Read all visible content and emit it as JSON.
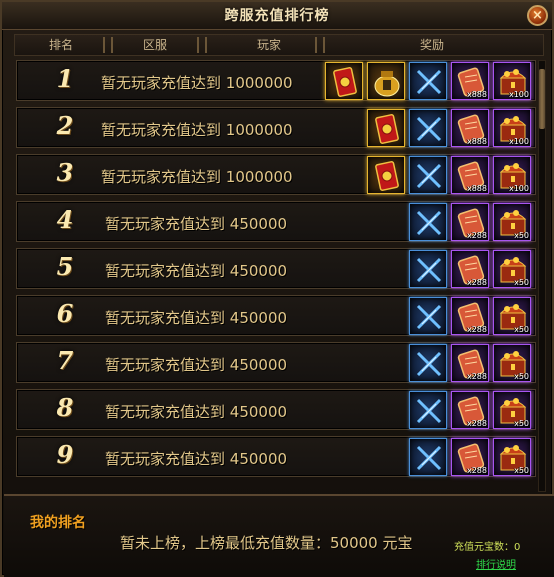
{
  "window": {
    "title": "跨服充值排行榜",
    "close_label": "×"
  },
  "columns": {
    "rank": "排名",
    "server": "区服",
    "player": "玩家",
    "reward": "奖励"
  },
  "rows": [
    {
      "rank": "1",
      "text": "暂无玩家充值达到",
      "amount": "1000000",
      "items": [
        {
          "icon": "red-card-icon",
          "tier": "gold",
          "qty": ""
        },
        {
          "icon": "gold-bag-icon",
          "tier": "gold",
          "qty": ""
        },
        {
          "icon": "crossed-swords-icon",
          "tier": "blue",
          "qty": ""
        },
        {
          "icon": "scroll-icon",
          "tier": "purple",
          "qty": "x888"
        },
        {
          "icon": "treasure-chest-icon",
          "tier": "purple",
          "qty": "x100"
        }
      ]
    },
    {
      "rank": "2",
      "text": "暂无玩家充值达到",
      "amount": "1000000",
      "items": [
        {
          "icon": "red-card-icon",
          "tier": "gold",
          "qty": ""
        },
        {
          "icon": "crossed-swords-icon",
          "tier": "blue",
          "qty": ""
        },
        {
          "icon": "scroll-icon",
          "tier": "purple",
          "qty": "x888"
        },
        {
          "icon": "treasure-chest-icon",
          "tier": "purple",
          "qty": "x100"
        }
      ]
    },
    {
      "rank": "3",
      "text": "暂无玩家充值达到",
      "amount": "1000000",
      "items": [
        {
          "icon": "red-card-icon",
          "tier": "gold",
          "qty": ""
        },
        {
          "icon": "crossed-swords-icon",
          "tier": "blue",
          "qty": ""
        },
        {
          "icon": "scroll-icon",
          "tier": "purple",
          "qty": "x888"
        },
        {
          "icon": "treasure-chest-icon",
          "tier": "purple",
          "qty": "x100"
        }
      ]
    },
    {
      "rank": "4",
      "text": "暂无玩家充值达到",
      "amount": "450000",
      "items": [
        {
          "icon": "crossed-swords-icon",
          "tier": "blue",
          "qty": ""
        },
        {
          "icon": "scroll-icon",
          "tier": "purple",
          "qty": "x288"
        },
        {
          "icon": "treasure-chest-icon",
          "tier": "purple",
          "qty": "x50"
        }
      ]
    },
    {
      "rank": "5",
      "text": "暂无玩家充值达到",
      "amount": "450000",
      "items": [
        {
          "icon": "crossed-swords-icon",
          "tier": "blue",
          "qty": ""
        },
        {
          "icon": "scroll-icon",
          "tier": "purple",
          "qty": "x288"
        },
        {
          "icon": "treasure-chest-icon",
          "tier": "purple",
          "qty": "x50"
        }
      ]
    },
    {
      "rank": "6",
      "text": "暂无玩家充值达到",
      "amount": "450000",
      "items": [
        {
          "icon": "crossed-swords-icon",
          "tier": "blue",
          "qty": ""
        },
        {
          "icon": "scroll-icon",
          "tier": "purple",
          "qty": "x288"
        },
        {
          "icon": "treasure-chest-icon",
          "tier": "purple",
          "qty": "x50"
        }
      ]
    },
    {
      "rank": "7",
      "text": "暂无玩家充值达到",
      "amount": "450000",
      "items": [
        {
          "icon": "crossed-swords-icon",
          "tier": "blue",
          "qty": ""
        },
        {
          "icon": "scroll-icon",
          "tier": "purple",
          "qty": "x288"
        },
        {
          "icon": "treasure-chest-icon",
          "tier": "purple",
          "qty": "x50"
        }
      ]
    },
    {
      "rank": "8",
      "text": "暂无玩家充值达到",
      "amount": "450000",
      "items": [
        {
          "icon": "crossed-swords-icon",
          "tier": "blue",
          "qty": ""
        },
        {
          "icon": "scroll-icon",
          "tier": "purple",
          "qty": "x288"
        },
        {
          "icon": "treasure-chest-icon",
          "tier": "purple",
          "qty": "x50"
        }
      ]
    },
    {
      "rank": "9",
      "text": "暂无玩家充值达到",
      "amount": "450000",
      "items": [
        {
          "icon": "crossed-swords-icon",
          "tier": "blue",
          "qty": ""
        },
        {
          "icon": "scroll-icon",
          "tier": "purple",
          "qty": "x288"
        },
        {
          "icon": "treasure-chest-icon",
          "tier": "purple",
          "qty": "x50"
        }
      ]
    }
  ],
  "footer": {
    "my_rank_label": "我的排名",
    "status_text": "暂未上榜，上榜最低充值数量：50000 元宝",
    "recharge_label": "充值元宝数：",
    "recharge_value": "0",
    "rules_link": "排行说明"
  },
  "colors": {
    "gold_frame": "#e6b530",
    "blue_frame": "#4a8fd8",
    "purple_frame": "#a855f0",
    "accent_orange": "#f0a020",
    "link_green": "#2fd84a"
  }
}
